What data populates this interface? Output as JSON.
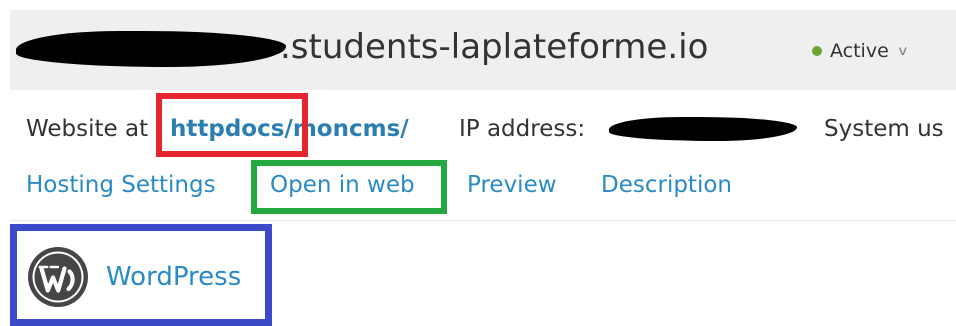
{
  "header": {
    "domain_suffix": ".students-laplateforme.io",
    "status_label": "Active",
    "status_color": "#6aa533"
  },
  "info": {
    "website_label": "Website at",
    "website_path": "httpdocs/moncms/",
    "ip_label": "IP address:",
    "system_user_label": "System us"
  },
  "links": {
    "hosting_settings": "Hosting Settings",
    "open_in_web": "Open in web",
    "preview": "Preview",
    "description": "Description"
  },
  "app": {
    "name": "WordPress",
    "icon": "wordpress-icon"
  },
  "colors": {
    "link": "#2a8bc4",
    "annotation_red": "#e3262f",
    "annotation_green": "#22a83e",
    "annotation_blue": "#3c49c9"
  }
}
